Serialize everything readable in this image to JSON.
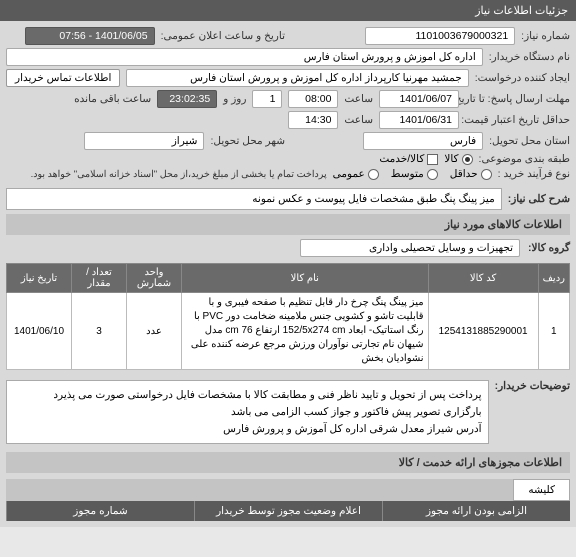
{
  "headers": {
    "main": "جزئیات اطلاعات نیاز",
    "goods": "اطلاعات کالاهای مورد نیاز",
    "permit": "اطلاعات مجوزهای ارائه خدمت / کالا"
  },
  "labels": {
    "req_no": "شماره نیاز:",
    "announce": "تاریخ و ساعت اعلان عمومی:",
    "buyer": "نام دستگاه خریدار:",
    "requester": "ایجاد کننده درخواست:",
    "contact_btn": "اطلاعات تماس خریدار",
    "deadline": "مهلت ارسال پاسخ: تا تاریخ:",
    "hour": "ساعت",
    "row": "روز و",
    "remain": "ساعت باقی مانده",
    "validity": "حداقل تاریخ اعتبار قیمت: تا تاریخ:",
    "province": "استان محل تحویل:",
    "city": "شهر محل تحویل:",
    "category": "طبقه بندی موضوعی:",
    "goods_chk": "کالا",
    "service_chk": "کالا/خدمت",
    "process": "نوع فرآیند خرید :",
    "proc1": "حداقل",
    "proc2": "متوسط",
    "proc3": "عمومی",
    "proc_note": "پرداخت تمام یا بخشی از مبلغ خرید،از محل \"اسناد خزانه اسلامی\" خواهد بود.",
    "desc_title": "شرح کلی نیاز:",
    "group": "گروه کالا:",
    "explain": "توضیحات خریدار:"
  },
  "fields": {
    "req_no": "1101003679000321",
    "announce": "1401/06/05 - 07:56",
    "buyer": "اداره کل اموزش و پرورش استان فارس",
    "requester": "جمشید مهرنیا کارپرداز اداره کل اموزش و پرورش استان فارس",
    "deadline_date": "1401/06/07",
    "deadline_time": "08:00",
    "days": "1",
    "remain": "23:02:35",
    "validity_date": "1401/06/31",
    "validity_time": "14:30",
    "province": "فارس",
    "city": "شیراز",
    "desc": "میز پینگ پنگ طبق مشخصات فایل پیوست و عکس نمونه",
    "group": "تجهیزات و وسایل تحصیلی واداری"
  },
  "table": {
    "headers": [
      "ردیف",
      "کد کالا",
      "نام کالا",
      "واحد شمارش",
      "تعداد / مقدار",
      "تاریخ نیاز"
    ],
    "row": {
      "idx": "1",
      "code": "1254131885290001",
      "name": "میز پینگ پنگ چرخ دار قابل تنظیم با صفحه فیبری و با قابلیت تاشو و کشویی جنس ملامینه ضخامت دور PVC با رنگ استاتیک- ابعاد 152/5x274 cm ارتفاع 76 cm مدل شیهان نام تجارتی نوآوران ورزش مرجع عرضه کننده علی نشواديان بخش",
      "unit": "عدد",
      "qty": "3",
      "date": "1401/06/10"
    }
  },
  "explain_text": "پرداخت پس از تحویل و تایید ناظر فنی و مطابقت کالا با مشخصات فایل درخواستی صورت می پذیرد\nبارگزاری تصویر پیش فاکتور و جواز کسب الزامی می باشد\nآدرس شیراز معدل شرقی اداره کل آموزش و پرورش فارس",
  "tabs": [
    "کلیشه"
  ],
  "bottom": [
    "الزامی بودن ارائه مجوز",
    "اعلام وضعیت مجوز توسط خریدار",
    "شماره مجوز"
  ]
}
